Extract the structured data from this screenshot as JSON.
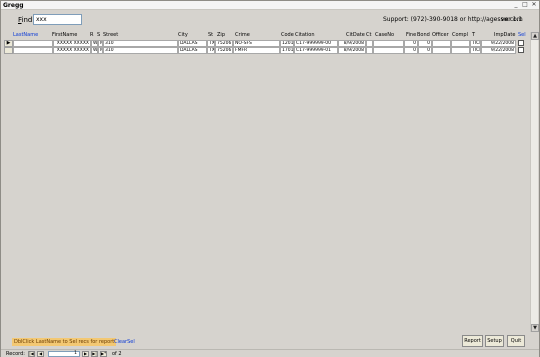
{
  "window": {
    "title": "Gregg"
  },
  "header": {
    "find_label_accel": "F",
    "find_label_rest": "ind:",
    "find_value": "xxx",
    "support": "Support: (972)-390-9018 or http://agessw.com",
    "version": "ver 1.1"
  },
  "columns": {
    "lastname": "LastName",
    "firstname": "FirstName",
    "r": "R",
    "s": "S",
    "street": "Street",
    "city": "City",
    "st": "St",
    "zip": "Zip",
    "crime": "Crime",
    "code": "Code",
    "citation": "Citation",
    "citdate": "CitDate",
    "ct": "Ct",
    "caseno": "CaseNo",
    "fine": "Fine",
    "bond": "Bond",
    "officer": "Officer",
    "compl": "Compl",
    "t": "T",
    "impdate": "ImpDate",
    "sel": "Sel"
  },
  "rows": [
    {
      "marker": "▶",
      "lastname": "",
      "firstname": "XXXXX XXXXX",
      "r": "W",
      "s": "M",
      "street": "310",
      "city": "DALLAS",
      "st": "TX",
      "zip": "75206",
      "crime": "NO-SFS",
      "code": "1201",
      "citation": "C17-999999-00",
      "citdate": "8/9/2008",
      "ct": "",
      "caseno": "",
      "fine": "0",
      "bond": "0",
      "officer": "",
      "compl": "",
      "t": "TICK",
      "impdate": "9/22/2008",
      "sel": false
    },
    {
      "marker": "",
      "lastname": "",
      "firstname": "XXXXX XXXXX",
      "r": "W",
      "s": "M",
      "street": "310",
      "city": "DALLAS",
      "st": "TX",
      "zip": "75206",
      "crime": "FMFR",
      "code": "1701",
      "citation": "C17-999999-01",
      "citdate": "8/9/2008",
      "ct": "",
      "caseno": "",
      "fine": "0",
      "bond": "0",
      "officer": "",
      "compl": "",
      "t": "TICK",
      "impdate": "9/22/2008",
      "sel": false
    }
  ],
  "footer": {
    "hint": "DblClick LastName to Sel recs for report",
    "clearsel": "ClearSel",
    "buttons": {
      "report": "Report",
      "setup": "Setup",
      "quit": "Quit"
    }
  },
  "recordnav": {
    "label": "Record:",
    "current": "1",
    "of_label": "of",
    "total": "2"
  },
  "icons": {
    "first": "first-record-icon",
    "prev": "prev-record-icon",
    "next": "next-record-icon",
    "last": "last-record-icon",
    "new": "new-record-icon"
  }
}
